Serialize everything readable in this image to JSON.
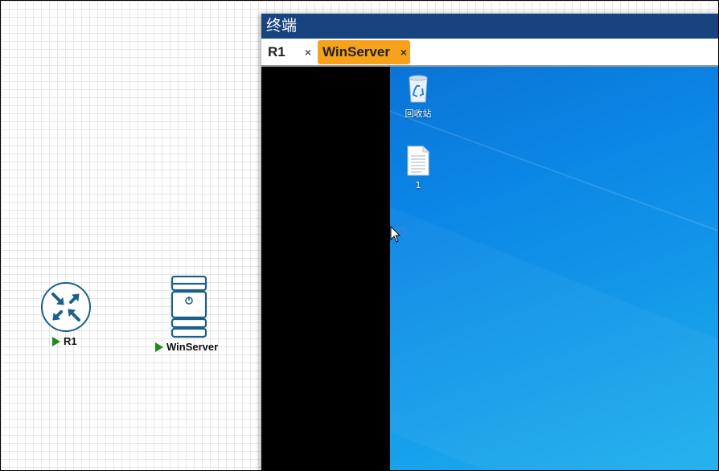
{
  "topology": {
    "nodes": [
      {
        "label": "R1",
        "icon": "router-icon",
        "status_icon": "play-icon"
      },
      {
        "label": "WinServer",
        "icon": "server-icon",
        "status_icon": "play-icon"
      }
    ]
  },
  "terminal": {
    "title": "终端",
    "tabs": [
      {
        "label": "R1",
        "close": "×",
        "active": false
      },
      {
        "label": "WinServer",
        "close": "×",
        "active": true
      }
    ],
    "desktop": {
      "icons": [
        {
          "label": "回收站",
          "icon": "recycle-bin-icon"
        },
        {
          "label": "1",
          "icon": "text-file-icon"
        }
      ]
    }
  },
  "colors": {
    "titlebar": "#17437e",
    "active_tab": "#f7a21b",
    "status_running": "#1d8a1d",
    "device_icon": "#1c5f8a",
    "desktop_blue": "#0b86e6"
  }
}
